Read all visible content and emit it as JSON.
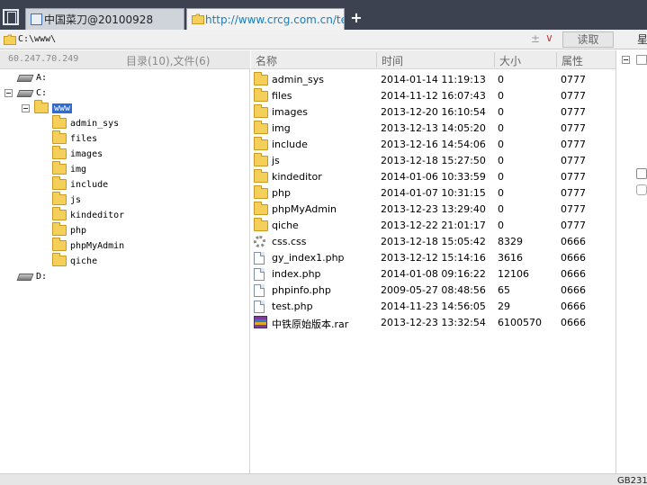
{
  "tabs": [
    {
      "label": "中国菜刀@20100928"
    },
    {
      "label": "http://www.crcg.com.cn/test...."
    }
  ],
  "address": {
    "path": "C:\\www\\",
    "sort_glyph": "±",
    "dropdown_glyph": "∨",
    "read_label": "读取",
    "star_label": "星"
  },
  "left_header": {
    "ip": "60.247.70.249",
    "counts": "目录(10),文件(6)"
  },
  "tree": {
    "drives": [
      "A:",
      "C:",
      "D:"
    ],
    "selected": "www",
    "folders": [
      "admin_sys",
      "files",
      "images",
      "img",
      "include",
      "js",
      "kindeditor",
      "php",
      "phpMyAdmin",
      "qiche"
    ]
  },
  "columns": {
    "name": "名称",
    "time": "时间",
    "size": "大小",
    "perm": "属性"
  },
  "files": [
    {
      "name": "admin_sys",
      "time": "2014-01-14 11:19:13",
      "size": "0",
      "perm": "0777",
      "icon": "folder-icon"
    },
    {
      "name": "files",
      "time": "2014-11-12 16:07:43",
      "size": "0",
      "perm": "0777",
      "icon": "folder-icon"
    },
    {
      "name": "images",
      "time": "2013-12-20 16:10:54",
      "size": "0",
      "perm": "0777",
      "icon": "folder-icon"
    },
    {
      "name": "img",
      "time": "2013-12-13 14:05:20",
      "size": "0",
      "perm": "0777",
      "icon": "folder-icon"
    },
    {
      "name": "include",
      "time": "2013-12-16 14:54:06",
      "size": "0",
      "perm": "0777",
      "icon": "folder-icon"
    },
    {
      "name": "js",
      "time": "2013-12-18 15:27:50",
      "size": "0",
      "perm": "0777",
      "icon": "folder-icon"
    },
    {
      "name": "kindeditor",
      "time": "2014-01-06 10:33:59",
      "size": "0",
      "perm": "0777",
      "icon": "folder-icon"
    },
    {
      "name": "php",
      "time": "2014-01-07 10:31:15",
      "size": "0",
      "perm": "0777",
      "icon": "folder-icon"
    },
    {
      "name": "phpMyAdmin",
      "time": "2013-12-23 13:29:40",
      "size": "0",
      "perm": "0777",
      "icon": "folder-icon"
    },
    {
      "name": "qiche",
      "time": "2013-12-22 21:01:17",
      "size": "0",
      "perm": "0777",
      "icon": "folder-icon"
    },
    {
      "name": "css.css",
      "time": "2013-12-18 15:05:42",
      "size": "8329",
      "perm": "0666",
      "icon": "css-file-icon"
    },
    {
      "name": "gy_index1.php",
      "time": "2013-12-12 15:14:16",
      "size": "3616",
      "perm": "0666",
      "icon": "php-file-icon"
    },
    {
      "name": "index.php",
      "time": "2014-01-08 09:16:22",
      "size": "12106",
      "perm": "0666",
      "icon": "php-file-icon"
    },
    {
      "name": "phpinfo.php",
      "time": "2009-05-27 08:48:56",
      "size": "65",
      "perm": "0666",
      "icon": "php-file-icon"
    },
    {
      "name": "test.php",
      "time": "2014-11-23 14:56:05",
      "size": "29",
      "perm": "0666",
      "icon": "php-file-icon"
    },
    {
      "name": "中铁原始版本.rar",
      "time": "2013-12-23 13:32:54",
      "size": "6100570",
      "perm": "0666",
      "icon": "rar-archive-icon"
    }
  ],
  "status": {
    "encoding": "GB231"
  },
  "colors": {
    "tabbar": "#3c4250",
    "selection": "#2f6bd4",
    "link": "#1b7cb6",
    "folder": "#f4cf5a"
  }
}
